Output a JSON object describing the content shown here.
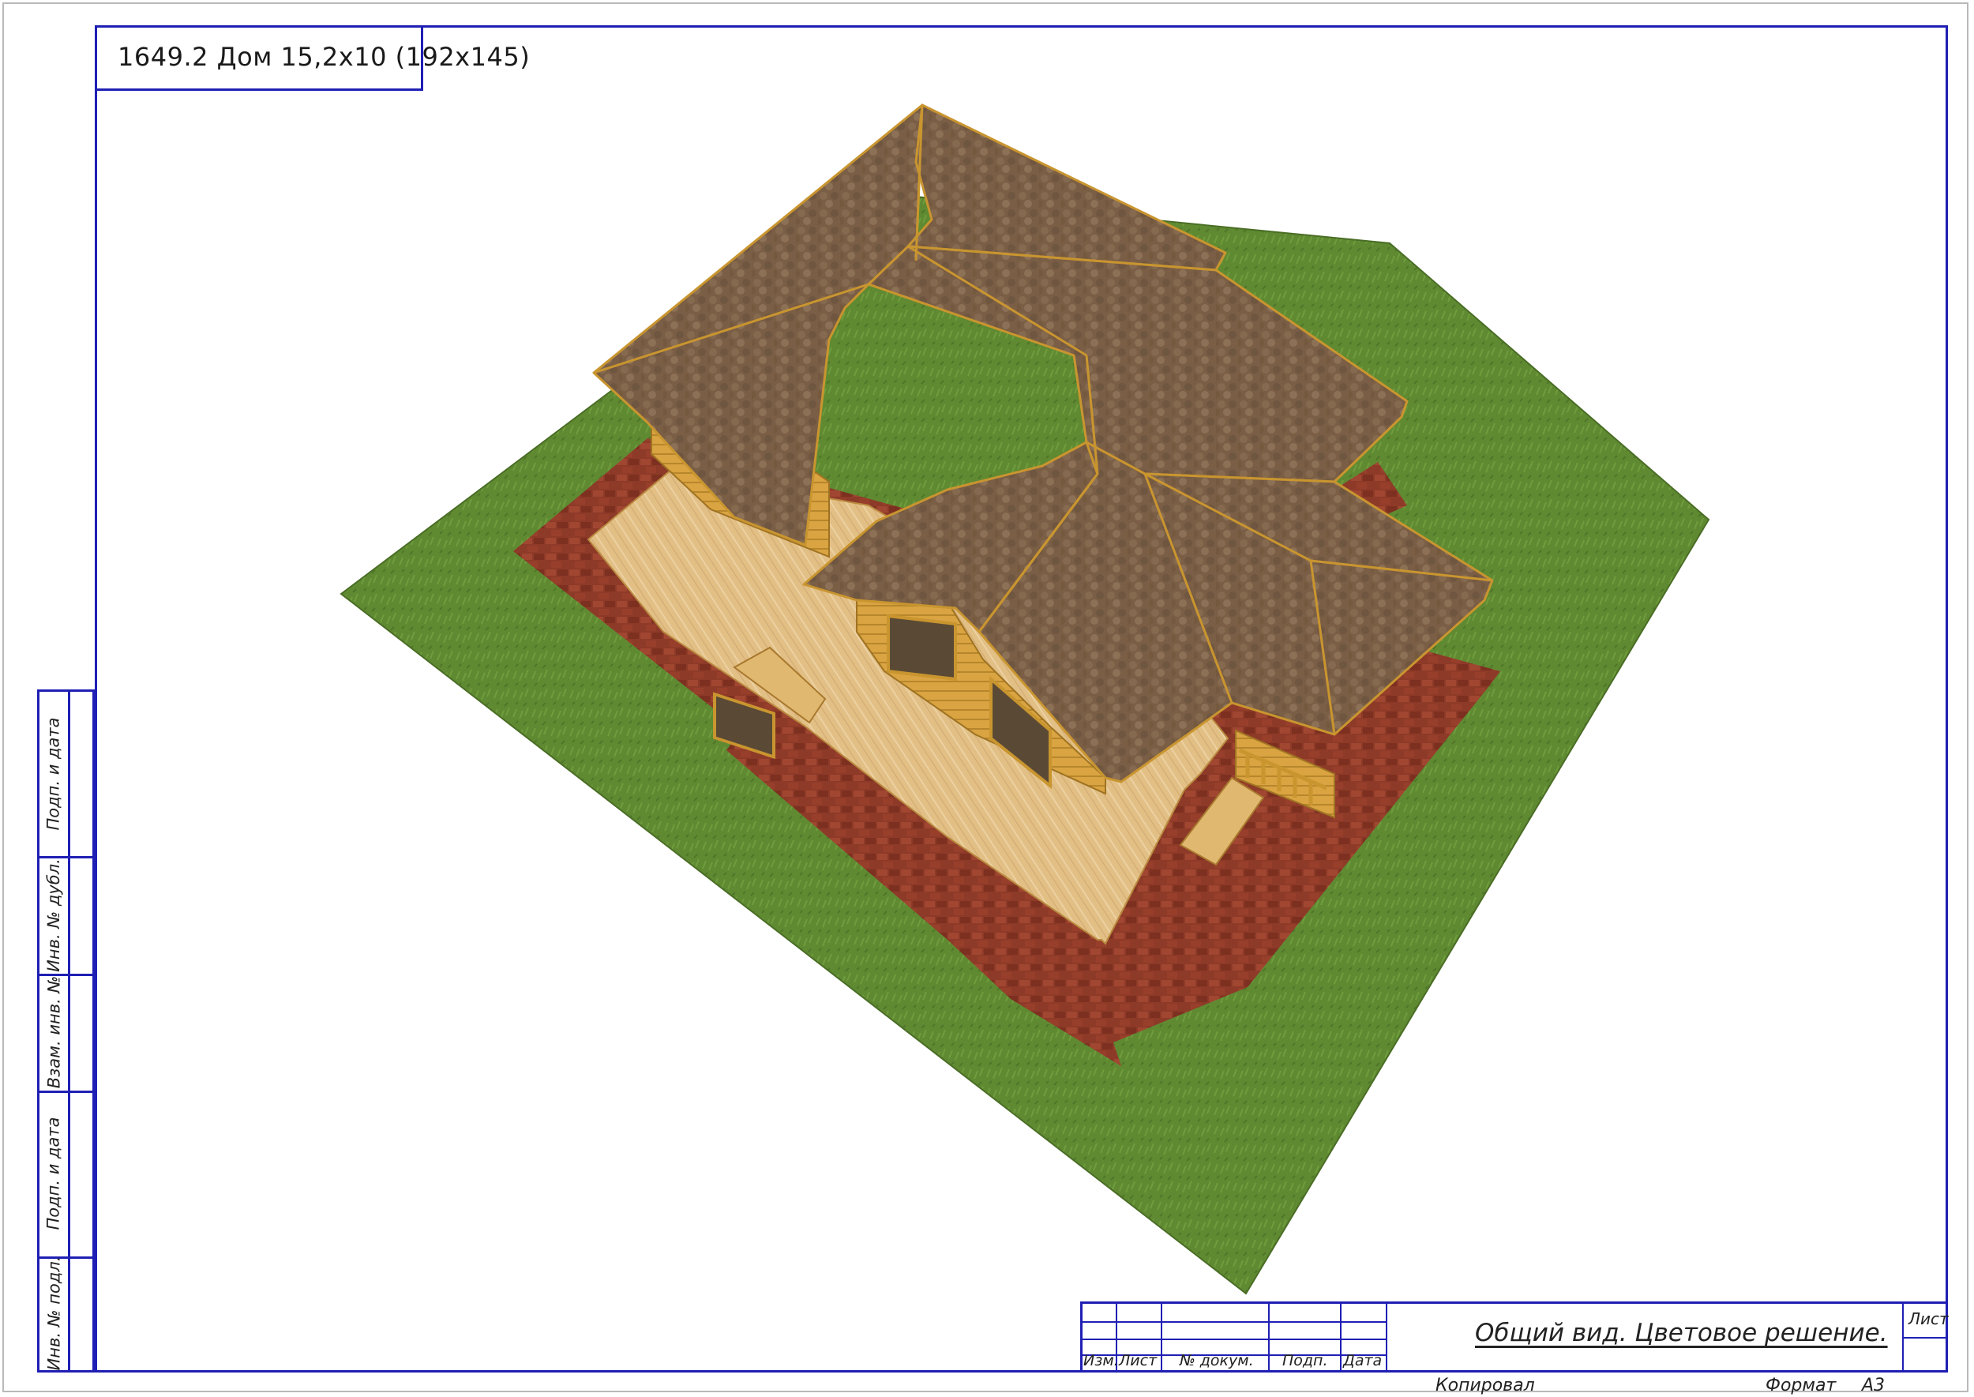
{
  "title": "1649.2 Дом 15,2х10 (192х145)",
  "side_stamp": [
    "Подп. и дата",
    "Инв. № дубл.",
    "Взам. инв. №",
    "Подп. и дата",
    "Инв. № подл."
  ],
  "title_block": {
    "columns": [
      "Изм.",
      "Лист",
      "№ докум.",
      "Подп.",
      "Дата"
    ],
    "drawing_title": "Общий вид. Цветовое решение.",
    "sheet_label": "Лист"
  },
  "footer": {
    "copied": "Копировал",
    "format_label": "Формат",
    "format_value": "А3"
  },
  "colors": {
    "frame": "#1f1fb4",
    "grass": "#5f8a32",
    "paving": "#8e3a28",
    "deck": "#e2bf85",
    "roof": "#7a5e45",
    "wood_trim": "#c9952f"
  }
}
